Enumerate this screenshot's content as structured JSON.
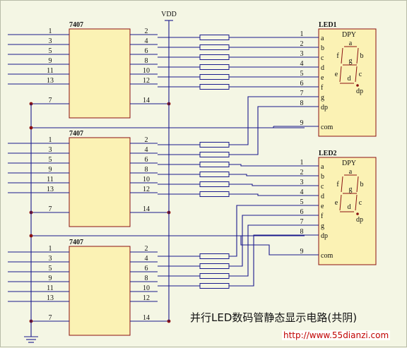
{
  "chip_title": "7407",
  "chips": [
    {
      "in_pins": [
        "1",
        "3",
        "5",
        "9",
        "11",
        "13"
      ],
      "out_pins": [
        "2",
        "4",
        "6",
        "8",
        "10",
        "12"
      ],
      "gnd_pin": "7",
      "vcc_pin": "14"
    },
    {
      "in_pins": [
        "1",
        "3",
        "5",
        "9",
        "11",
        "13"
      ],
      "out_pins": [
        "2",
        "4",
        "6",
        "8",
        "10",
        "12"
      ],
      "gnd_pin": "7",
      "vcc_pin": "14"
    },
    {
      "in_pins": [
        "1",
        "3",
        "5",
        "9",
        "11",
        "13"
      ],
      "out_pins": [
        "2",
        "4",
        "6",
        "8",
        "10",
        "12"
      ],
      "gnd_pin": "7",
      "vcc_pin": "14"
    }
  ],
  "power_label": "VDD",
  "displays": [
    {
      "name": "LED1",
      "part": "DPY",
      "pin_numbers": [
        "1",
        "2",
        "3",
        "4",
        "5",
        "6",
        "7",
        "8",
        "9"
      ],
      "pin_names": [
        "a",
        "b",
        "c",
        "d",
        "e",
        "f",
        "g",
        "dp",
        "com"
      ],
      "segment_letters": [
        "a",
        "b",
        "c",
        "d",
        "e",
        "f",
        "g",
        "dp"
      ]
    },
    {
      "name": "LED2",
      "part": "DPY",
      "pin_numbers": [
        "1",
        "2",
        "3",
        "4",
        "5",
        "6",
        "7",
        "8",
        "9"
      ],
      "pin_names": [
        "a",
        "b",
        "c",
        "d",
        "e",
        "f",
        "g",
        "dp",
        "com"
      ],
      "segment_letters": [
        "a",
        "b",
        "c",
        "d",
        "e",
        "f",
        "g",
        "dp"
      ]
    }
  ],
  "caption": "并行LED数码管静态显示电路(共阴)",
  "watermark": "http://www.55dianzi.com",
  "colors": {
    "background": "#f4f6e4",
    "wire": "#1a1a8c",
    "chip_fill": "#fbf2b4",
    "chip_border": "#8b1010",
    "junction": "#8b1010"
  }
}
